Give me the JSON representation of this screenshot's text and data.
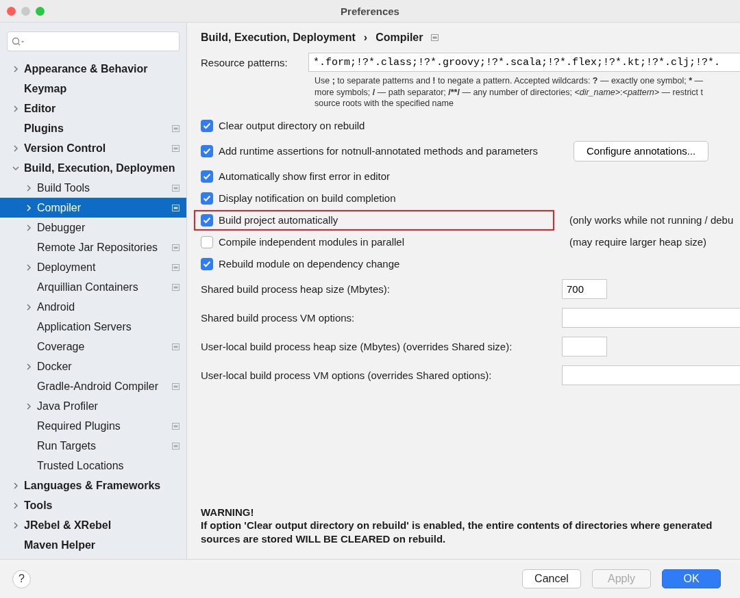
{
  "window": {
    "title": "Preferences"
  },
  "sidebar": {
    "items": [
      {
        "label": "Appearance & Behavior",
        "kind": "folder",
        "expanded": false,
        "selected": false,
        "badge": false
      },
      {
        "label": "Keymap",
        "kind": "leaf",
        "selected": false,
        "badge": false
      },
      {
        "label": "Editor",
        "kind": "folder",
        "expanded": false,
        "selected": false,
        "badge": false
      },
      {
        "label": "Plugins",
        "kind": "leaf",
        "selected": false,
        "badge": true
      },
      {
        "label": "Version Control",
        "kind": "folder",
        "expanded": false,
        "selected": false,
        "badge": true
      },
      {
        "label": "Build, Execution, Deploymen",
        "kind": "folder",
        "expanded": true,
        "selected": false,
        "badge": false,
        "children": [
          {
            "label": "Build Tools",
            "kind": "folder",
            "expanded": false,
            "selected": false,
            "badge": true
          },
          {
            "label": "Compiler",
            "kind": "folder",
            "expanded": false,
            "selected": true,
            "badge": true
          },
          {
            "label": "Debugger",
            "kind": "folder",
            "expanded": false,
            "selected": false,
            "badge": false
          },
          {
            "label": "Remote Jar Repositories",
            "kind": "leaf",
            "selected": false,
            "badge": true
          },
          {
            "label": "Deployment",
            "kind": "folder",
            "expanded": false,
            "selected": false,
            "badge": true
          },
          {
            "label": "Arquillian Containers",
            "kind": "leaf",
            "selected": false,
            "badge": true
          },
          {
            "label": "Android",
            "kind": "folder",
            "expanded": false,
            "selected": false,
            "badge": false
          },
          {
            "label": "Application Servers",
            "kind": "leaf",
            "selected": false,
            "badge": false
          },
          {
            "label": "Coverage",
            "kind": "leaf",
            "selected": false,
            "badge": true
          },
          {
            "label": "Docker",
            "kind": "folder",
            "expanded": false,
            "selected": false,
            "badge": false
          },
          {
            "label": "Gradle-Android Compiler",
            "kind": "leaf",
            "selected": false,
            "badge": true
          },
          {
            "label": "Java Profiler",
            "kind": "folder",
            "expanded": false,
            "selected": false,
            "badge": false
          },
          {
            "label": "Required Plugins",
            "kind": "leaf",
            "selected": false,
            "badge": true
          },
          {
            "label": "Run Targets",
            "kind": "leaf",
            "selected": false,
            "badge": true
          },
          {
            "label": "Trusted Locations",
            "kind": "leaf",
            "selected": false,
            "badge": false
          }
        ]
      },
      {
        "label": "Languages & Frameworks",
        "kind": "folder",
        "expanded": false,
        "selected": false,
        "badge": false
      },
      {
        "label": "Tools",
        "kind": "folder",
        "expanded": false,
        "selected": false,
        "badge": false
      },
      {
        "label": "JRebel & XRebel",
        "kind": "folder",
        "expanded": false,
        "selected": false,
        "badge": false
      },
      {
        "label": "Maven Helper",
        "kind": "leaf",
        "selected": false,
        "badge": false
      }
    ]
  },
  "breadcrumb": {
    "parent": "Build, Execution, Deployment",
    "separator": "›",
    "current": "Compiler"
  },
  "resource_patterns": {
    "label": "Resource patterns:",
    "value": "*.form;!?*.class;!?*.groovy;!?*.scala;!?*.flex;!?*.kt;!?*.clj;!?*.",
    "help_lines": [
      [
        {
          "text": "Use ",
          "kind": "plain"
        },
        {
          "text": ";",
          "kind": "bold"
        },
        {
          "text": " to separate patterns and ",
          "kind": "plain"
        },
        {
          "text": "!",
          "kind": "bold"
        },
        {
          "text": " to negate a pattern. Accepted wildcards: ",
          "kind": "plain"
        },
        {
          "text": "?",
          "kind": "bold"
        },
        {
          "text": " — exactly one symbol; ",
          "kind": "plain"
        },
        {
          "text": "*",
          "kind": "bold"
        },
        {
          "text": " —",
          "kind": "plain"
        }
      ],
      [
        {
          "text": "more symbols; ",
          "kind": "plain"
        },
        {
          "text": "/",
          "kind": "bold"
        },
        {
          "text": " — path separator; ",
          "kind": "plain"
        },
        {
          "text": "/**/",
          "kind": "bold"
        },
        {
          "text": " — any number of directories; ",
          "kind": "plain"
        },
        {
          "text": "<dir_name>",
          "kind": "italic"
        },
        {
          "text": ":",
          "kind": "plain"
        },
        {
          "text": "<pattern>",
          "kind": "italic"
        },
        {
          "text": " — restrict t",
          "kind": "plain"
        }
      ],
      [
        {
          "text": "source roots with the specified name",
          "kind": "plain"
        }
      ]
    ]
  },
  "checks": [
    {
      "label": "Clear output directory on rebuild",
      "checked": true,
      "highlighted": false
    },
    {
      "label": "Add runtime assertions for notnull-annotated methods and parameters",
      "checked": true,
      "highlighted": false,
      "button": "Configure annotations..."
    },
    {
      "label": "Automatically show first error in editor",
      "checked": true,
      "highlighted": false
    },
    {
      "label": "Display notification on build completion",
      "checked": true,
      "highlighted": false
    },
    {
      "label": "Build project automatically",
      "checked": true,
      "highlighted": true,
      "note": "(only works while not running / debu"
    },
    {
      "label": "Compile independent modules in parallel",
      "checked": false,
      "highlighted": false,
      "note": "(may require larger heap size)"
    },
    {
      "label": "Rebuild module on dependency change",
      "checked": true,
      "highlighted": false
    }
  ],
  "fields": [
    {
      "label": "Shared build process heap size (Mbytes):",
      "kind": "short",
      "value": "700"
    },
    {
      "label": "Shared build process VM options:",
      "kind": "long"
    },
    {
      "label": "User-local build process heap size (Mbytes) (overrides Shared size):",
      "kind": "short"
    },
    {
      "label": "User-local build process VM options (overrides Shared options):",
      "kind": "long"
    }
  ],
  "warning": {
    "title": "WARNING!",
    "text": "If option 'Clear output directory on rebuild' is enabled, the entire contents of directories where generated sources are stored WILL BE CLEARED on rebuild."
  },
  "footer": {
    "help": "?",
    "buttons": [
      {
        "label": "Cancel",
        "kind": "normal",
        "disabled": false
      },
      {
        "label": "Apply",
        "kind": "normal",
        "disabled": true
      },
      {
        "label": "OK",
        "kind": "default",
        "disabled": false
      }
    ]
  }
}
